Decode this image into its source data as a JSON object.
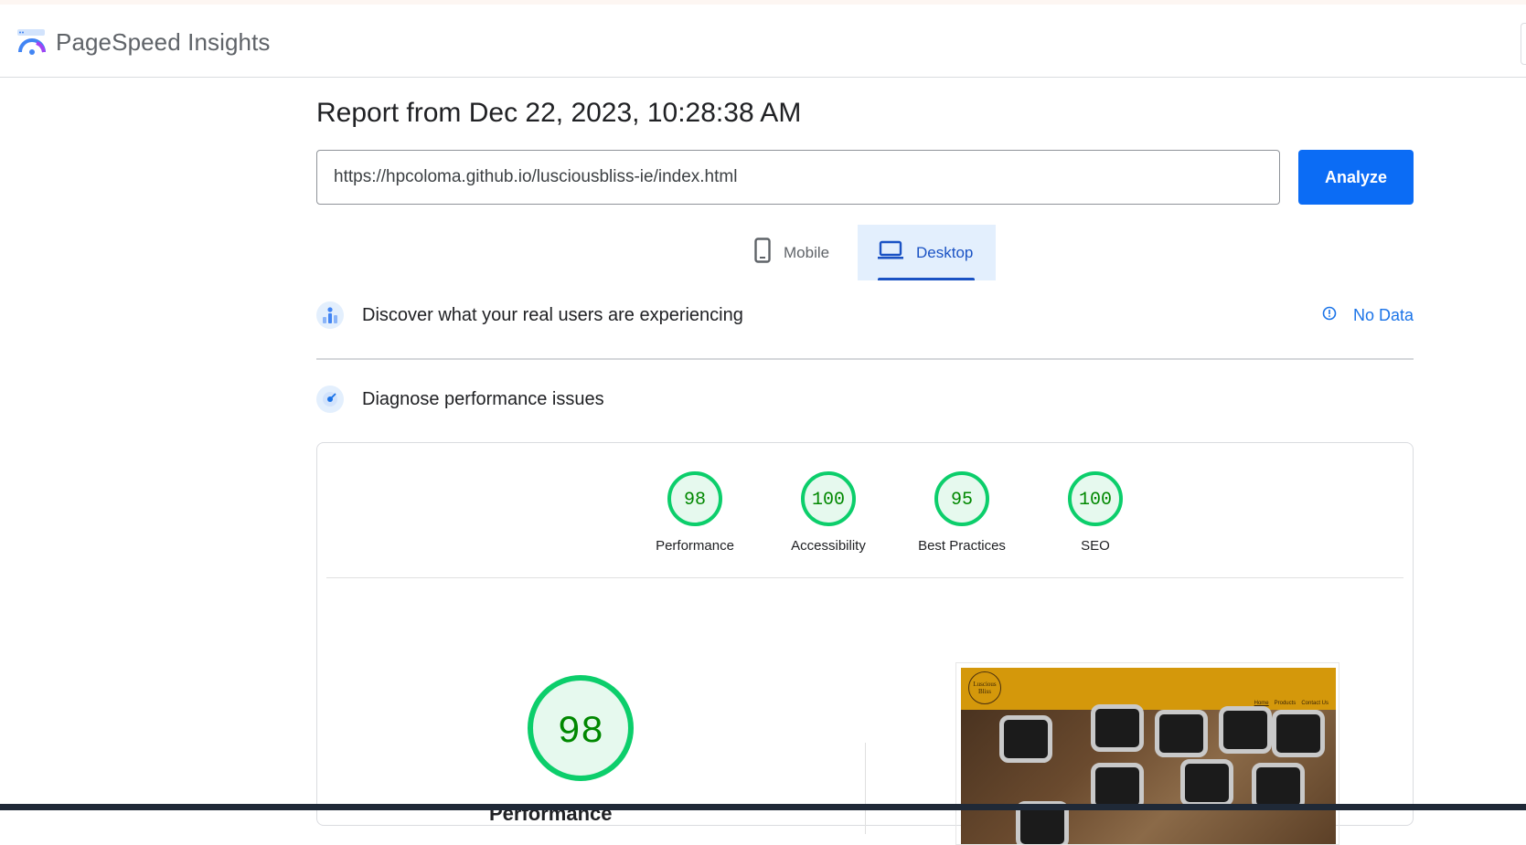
{
  "header": {
    "brand": "PageSpeed Insights",
    "logo_icon": "pagespeed-logo-icon"
  },
  "report": {
    "title": "Report from Dec 22, 2023, 10:28:38 AM"
  },
  "url_input": {
    "value": "https://hpcoloma.github.io/lusciousbliss-ie/index.html"
  },
  "analyze_button": {
    "label": "Analyze"
  },
  "tabs": [
    {
      "label": "Mobile",
      "icon": "phone-icon",
      "selected": false
    },
    {
      "label": "Desktop",
      "icon": "laptop-icon",
      "selected": true
    }
  ],
  "field_data": {
    "title": "Discover what your real users are experiencing",
    "status": "No Data"
  },
  "diagnose": {
    "title": "Diagnose performance issues"
  },
  "scores": [
    {
      "value": "98",
      "label": "Performance"
    },
    {
      "value": "100",
      "label": "Accessibility"
    },
    {
      "value": "95",
      "label": "Best Practices"
    },
    {
      "value": "100",
      "label": "SEO"
    }
  ],
  "main_score": {
    "value": "98",
    "label": "Performance"
  },
  "screenshot": {
    "logo_text": "Luscious Bliss",
    "nav_links": [
      "Home",
      "Products",
      "Contact Us"
    ]
  },
  "colors": {
    "pass": "#0cce6b",
    "pass_text": "#008800",
    "pass_fill": "#e6f9ee",
    "accent": "#0b6cf5"
  }
}
